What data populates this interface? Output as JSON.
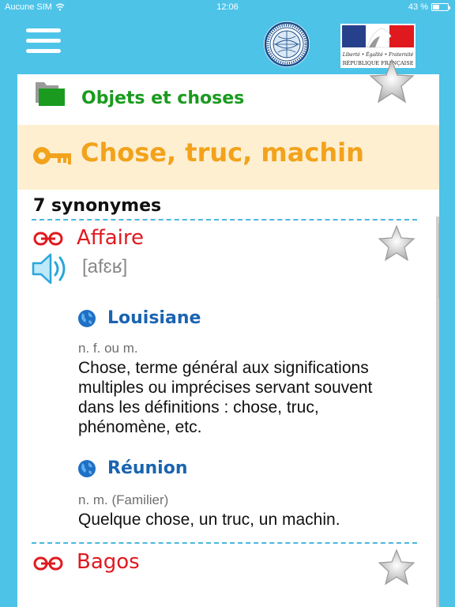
{
  "status_bar": {
    "carrier": "Aucune SIM",
    "time": "12:06",
    "battery_text": "43 %",
    "battery_level": 0.43
  },
  "header": {
    "menu_icon": "hamburger-icon",
    "seal_icon": "academy-seal-icon",
    "logo_icon": "republique-francaise-logo",
    "logo_motto": "Liberté • Égalité • Fraternité",
    "logo_name": "RÉPUBLIQUE FRANÇAISE"
  },
  "category": {
    "icon": "folder-icon",
    "title": "Objets et choses",
    "color": "#1a9b1f"
  },
  "headword": {
    "icon": "key-icon",
    "title": "Chose, truc, machin",
    "color": "#f2a21b",
    "background": "#fdefd0",
    "favorite_icon": "star-icon"
  },
  "synonyms": {
    "count_label": "7 synonymes",
    "items": [
      {
        "word": "Affaire",
        "phonetic": "[afɛʁ]",
        "link_icon": "link-icon",
        "sound_icon": "speaker-icon",
        "favorite_icon": "star-icon",
        "regions": [
          {
            "name": "Louisiane",
            "icon": "globe-icon",
            "grammar": "n. f. ou m.",
            "definition": "Chose, terme général aux significations multiples ou imprécises servant souvent dans les définitions : chose, truc, phénomène, etc."
          },
          {
            "name": "Réunion",
            "icon": "globe-icon",
            "grammar": "n. m. (Familier)",
            "definition": "Quelque chose, un truc, un machin."
          }
        ]
      },
      {
        "word": "Bagos",
        "link_icon": "link-icon",
        "favorite_icon": "star-icon"
      }
    ]
  },
  "colors": {
    "background": "#4ec3e8",
    "synonym_word": "#e0191f",
    "region_name": "#1a64b0",
    "divider": "#4ab6df"
  }
}
